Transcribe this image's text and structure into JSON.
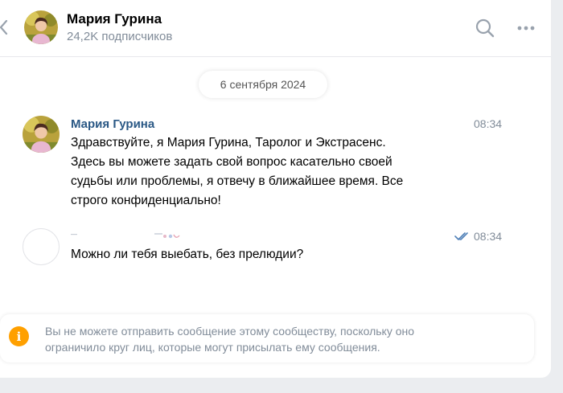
{
  "header": {
    "back_icon": "chevron-left-icon",
    "name": "Мария Гурина",
    "subscribers": "24,2K подписчиков",
    "search_icon": "search-icon",
    "more_icon": "more-horizontal-icon"
  },
  "date_separator": "6 сентября 2024",
  "messages": [
    {
      "sender": "Мария Гурина",
      "time": "08:34",
      "text": [
        "Здравствуйте, я Мария Гурина, Таролог и Экстрасенс.",
        "Здесь вы можете задать свой вопрос касательно своей",
        "судьбы или проблемы, я отвечу в ближайшее время. Все",
        "строго конфиденциально!"
      ]
    },
    {
      "sender": "",
      "time": "08:34",
      "status_icon": "double-check-icon",
      "text": [
        "Можно ли тебя выебать, без прелюдии?"
      ]
    }
  ],
  "notice": {
    "icon": "info-icon",
    "icon_glyph": "i",
    "text": [
      "Вы не можете отправить сообщение этому сообществу, поскольку оно",
      "ограничило круг лиц, которые могут присылать ему сообщения."
    ]
  },
  "colors": {
    "accent": "#2a5885",
    "muted": "#818c99",
    "warning": "#ffa000",
    "check": "#5181b8"
  }
}
